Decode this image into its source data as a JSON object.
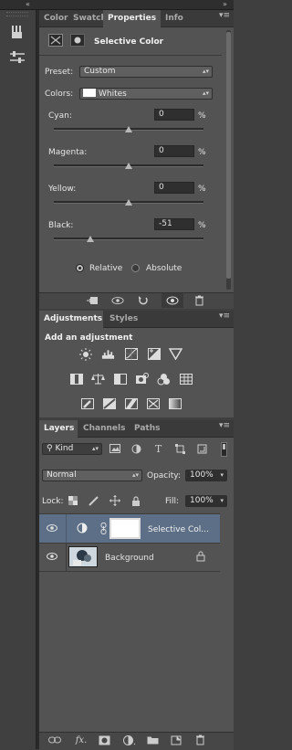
{
  "properties_panel": {
    "tabs": [
      "Color",
      "Swatch",
      "Properties",
      "Info"
    ],
    "active_tab": "Properties",
    "title": "Selective Color",
    "preset_label": "Preset:",
    "preset_value": "Custom",
    "colors_label": "Colors:",
    "colors_value": "Whites",
    "sliders": [
      {
        "label": "Cyan:",
        "value": "0",
        "unit": "%",
        "level": 0.5
      },
      {
        "label": "Magenta:",
        "value": "0",
        "unit": "%",
        "level": 0.5
      },
      {
        "label": "Yellow:",
        "value": "0",
        "unit": "%",
        "level": 0.5
      },
      {
        "label": "Black:",
        "value": "-51",
        "unit": "%",
        "level": 0.245
      }
    ],
    "method_relative": "Relative",
    "method_absolute": "Absolute",
    "method_selected": "Relative"
  },
  "adjustments_panel": {
    "tabs": [
      "Adjustments",
      "Styles"
    ],
    "active_tab": "Adjustments",
    "heading": "Add an adjustment"
  },
  "layers_panel": {
    "tabs": [
      "Layers",
      "Channels",
      "Paths"
    ],
    "active_tab": "Layers",
    "filter_kind": "Kind",
    "blend_mode": "Normal",
    "opacity_label": "Opacity:",
    "opacity_value": "100%",
    "lock_label": "Lock:",
    "fill_label": "Fill:",
    "fill_value": "100%",
    "layers": [
      {
        "name": "Selective Col...",
        "type": "adjustment",
        "selected": true
      },
      {
        "name": "Background",
        "type": "image",
        "locked": true,
        "selected": false
      }
    ]
  },
  "colors": {
    "panel_bg": "#535353",
    "selected_layer": "#5c6f86",
    "dark_field": "#2f2f2f"
  }
}
